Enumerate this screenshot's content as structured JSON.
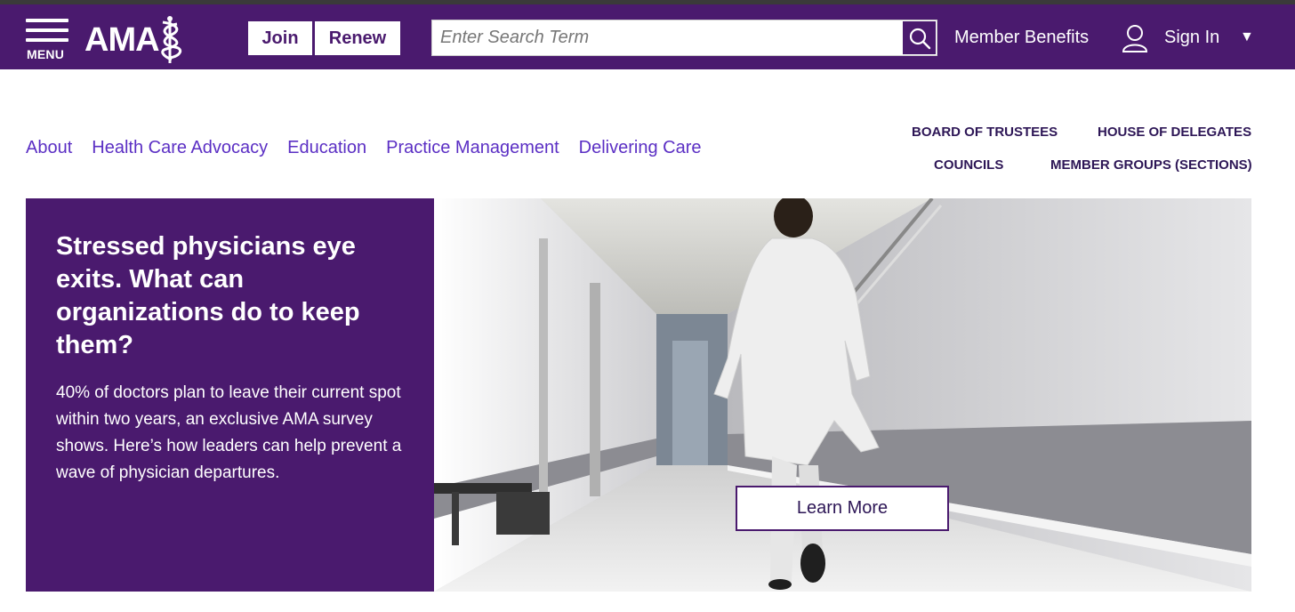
{
  "header": {
    "menu_label": "MENU",
    "logo_text": "AMA",
    "join_label": "Join",
    "renew_label": "Renew",
    "search_placeholder": "Enter Search Term",
    "member_benefits_label": "Member Benefits",
    "signin_label": "Sign In",
    "caret": "▼"
  },
  "nav": {
    "items": [
      "About",
      "Health Care Advocacy",
      "Education",
      "Practice Management",
      "Delivering Care"
    ]
  },
  "secondary_nav": {
    "board": "BOARD OF TRUSTEES",
    "house": "HOUSE OF DELEGATES",
    "councils": "COUNCILS",
    "member_groups": "MEMBER GROUPS (SECTIONS)"
  },
  "hero": {
    "title": "Stressed physicians eye exits. What can organizations do to keep them?",
    "description": "40% of doctors plan to leave their current spot within two years, an exclusive AMA survey shows. Here’s how leaders can help prevent a wave of physician departures.",
    "cta_label": "Learn More"
  },
  "colors": {
    "brand_purple": "#4a1a6e",
    "link_purple": "#5b2fc4",
    "dark_purple": "#2d1656"
  },
  "icons": {
    "menu": "hamburger-icon",
    "logo": "ama-caduceus-icon",
    "search": "search-icon",
    "user": "user-icon",
    "caret": "caret-down-icon"
  }
}
